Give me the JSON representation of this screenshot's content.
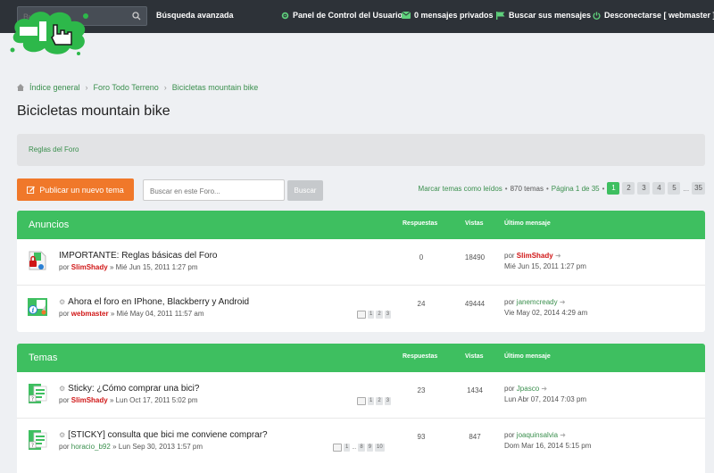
{
  "topbar": {
    "search_placeholder": "Buscar",
    "advanced_search": "Búsqueda avanzada",
    "links": [
      {
        "label": "Panel de Control del Usuario",
        "icon": "gear-icon"
      },
      {
        "label": "0 mensajes privados",
        "icon": "envelope-icon"
      },
      {
        "label": "Buscar sus mensajes",
        "icon": "flag-icon"
      },
      {
        "label": "Desconectarse [ webmaster ]",
        "icon": "power-icon"
      }
    ]
  },
  "breadcrumb": [
    "Índice general",
    "Foro Todo Terreno",
    "Bicicletas mountain bike"
  ],
  "page_title": "Bicicletas mountain bike",
  "rules_link": "Reglas del Foro",
  "actions": {
    "new_topic": "Publicar un nuevo tema",
    "forum_search_placeholder": "Buscar en este Foro...",
    "search_button": "Buscar"
  },
  "pagination": {
    "mark_read": "Marcar temas como leídos",
    "sep1": "•",
    "topics": "870 temas",
    "sep2": "•",
    "page_of": "Página 1 de 35",
    "sep3": "•",
    "pages": [
      "1",
      "2",
      "3",
      "4",
      "5",
      "...",
      "35"
    ]
  },
  "announcements": {
    "title": "Anuncios",
    "col_replies": "Respuestas",
    "col_views": "Vistas",
    "col_last": "Último mensaje",
    "rows": [
      {
        "title": "IMPORTANTE: Reglas básicas del Foro",
        "by": "por",
        "author": "SlimShady",
        "date": "» Mié Jun 15, 2011 1:27 pm",
        "pages": [],
        "replies": "0",
        "views": "18490",
        "last_by": "por",
        "last_user": "SlimShady",
        "last_date": "Mié Jun 15, 2011 1:27 pm"
      },
      {
        "title": "Ahora el foro en IPhone, Blackberry y Android",
        "by": "por",
        "author": "webmaster",
        "date": "» Mié May 04, 2011 11:57 am",
        "pages": [
          "1",
          "2",
          "3"
        ],
        "replies": "24",
        "views": "49444",
        "last_by": "por",
        "last_user": "janemcready",
        "last_date": "Vie May 02, 2014 4:29 am"
      }
    ]
  },
  "topics": {
    "title": "Temas",
    "col_replies": "Respuestas",
    "col_views": "Vistas",
    "col_last": "Último mensaje",
    "rows": [
      {
        "title": "Sticky: ¿Cómo comprar una bici?",
        "by": "por",
        "author": "SlimShady",
        "date": "» Lun Oct 17, 2011 5:02 pm",
        "pages": [
          "1",
          "2",
          "3"
        ],
        "replies": "23",
        "views": "1434",
        "last_by": "por",
        "last_user": "Jpasco",
        "last_date": "Lun Abr 07, 2014 7:03 pm"
      },
      {
        "title": "[STICKY] consulta que bici me conviene comprar?",
        "by": "por",
        "author": "horacio_b92",
        "date": "» Lun Sep 30, 2013 1:57 pm",
        "pages": [
          "1",
          "...",
          "8",
          "9",
          "10"
        ],
        "replies": "93",
        "views": "847",
        "last_by": "por",
        "last_user": "joaquinsalvia",
        "last_date": "Dom Mar 16, 2014 5:15 pm"
      }
    ]
  }
}
